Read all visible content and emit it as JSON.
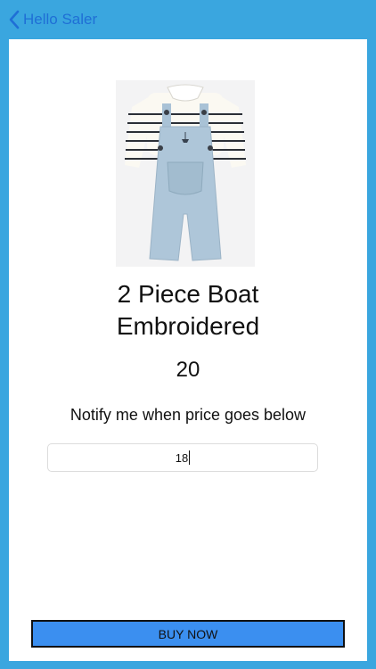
{
  "nav": {
    "back_label": "Hello Saler",
    "back_icon": "chevron-left-icon"
  },
  "product": {
    "image": "product-photo-overalls",
    "title_line1": "2 Piece Boat",
    "title_line2": "Embroidered",
    "price": "20"
  },
  "notify": {
    "label": "Notify me when price goes below",
    "input_value": "18"
  },
  "actions": {
    "buy_label": "BUY NOW"
  },
  "colors": {
    "bar": "#3aa6df",
    "link": "#1f6fd6",
    "button": "#3b8ff0"
  }
}
